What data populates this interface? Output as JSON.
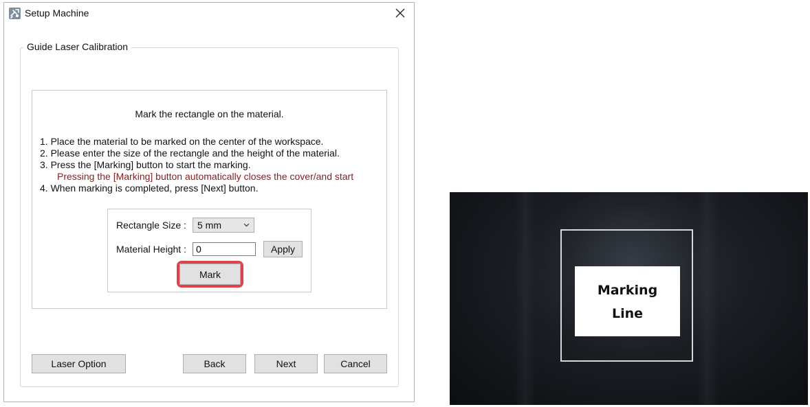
{
  "window": {
    "title": "Setup Machine",
    "icon": "setup-machine-icon"
  },
  "group": {
    "title": "Guide Laser Calibration"
  },
  "instructions": {
    "heading": "Mark the rectangle on the material.",
    "step1": "1. Place the material to be marked on the center of the workspace.",
    "step2": "2. Please enter the size of the rectangle and the height of the material.",
    "step3": "3. Press the [Marking] button to start the marking.",
    "note": "Pressing the [Marking] button automatically closes the cover/and start",
    "step4": "4. When marking is completed, press [Next] button.",
    "note_color": "#8b1c1c"
  },
  "settings": {
    "rect_size_label": "Rectangle Size :",
    "rect_size_value": "5 mm",
    "material_height_label": "Material Height :",
    "material_height_value": "0",
    "apply_label": "Apply",
    "mark_label": "Mark",
    "highlight_color": "#e0424b"
  },
  "footer": {
    "laser_option_label": "Laser Option",
    "back_label": "Back",
    "next_label": "Next",
    "cancel_label": "Cancel"
  },
  "photo": {
    "label_line1": "Marking",
    "label_line2": "Line"
  }
}
